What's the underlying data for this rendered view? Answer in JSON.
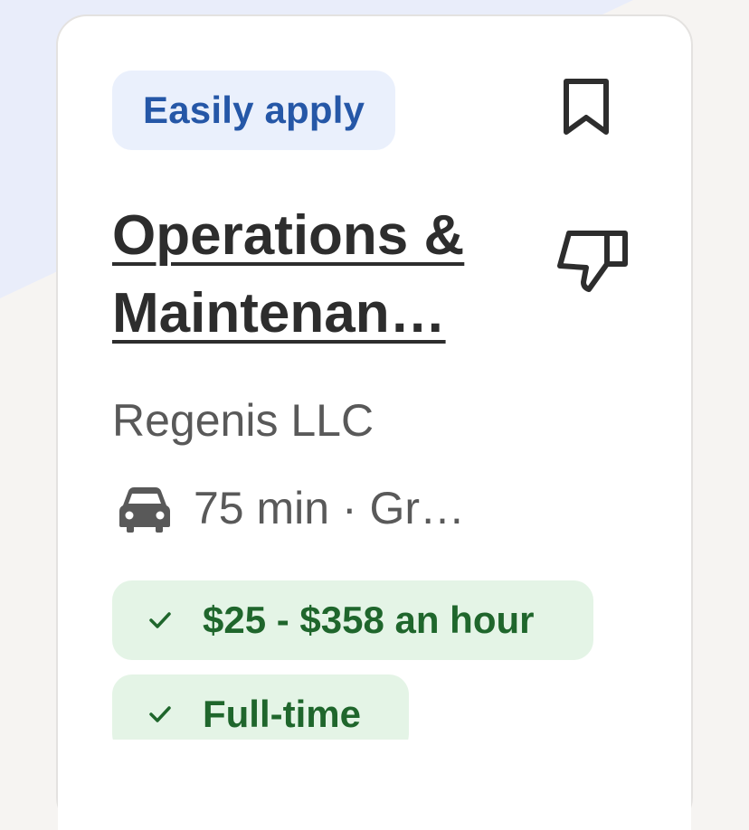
{
  "card": {
    "badge": "Easily apply",
    "title": "Operations & Maintenan…",
    "company": "Regenis LLC",
    "commute": "75 min · Gr…",
    "tags": [
      {
        "label": "$25 - $358 an hour",
        "icon": "check-icon"
      },
      {
        "label": "Full-time",
        "icon": "check-icon"
      }
    ],
    "icons": {
      "save": "bookmark-icon",
      "dislike": "thumbs-down-icon",
      "commute": "car-icon"
    }
  },
  "colors": {
    "badge_text": "#2557a7",
    "badge_bg": "#eaf0fc",
    "tag_text": "#1f662c",
    "tag_bg": "#e4f4e6"
  }
}
